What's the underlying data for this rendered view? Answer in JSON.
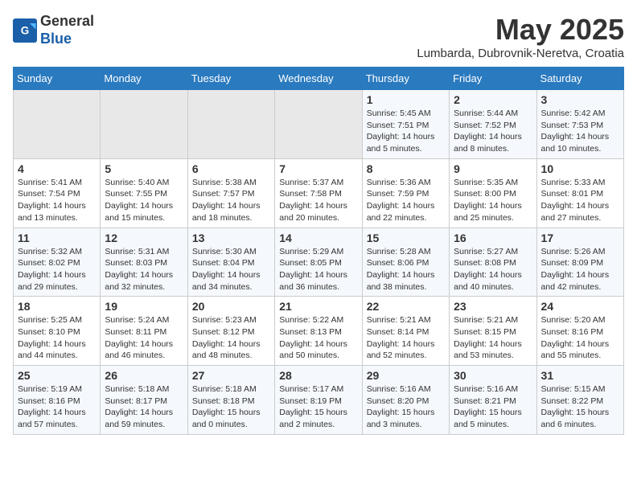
{
  "header": {
    "logo_general": "General",
    "logo_blue": "Blue",
    "month_title": "May 2025",
    "location": "Lumbarda, Dubrovnik-Neretva, Croatia"
  },
  "weekdays": [
    "Sunday",
    "Monday",
    "Tuesday",
    "Wednesday",
    "Thursday",
    "Friday",
    "Saturday"
  ],
  "weeks": [
    [
      {
        "day": "",
        "info": ""
      },
      {
        "day": "",
        "info": ""
      },
      {
        "day": "",
        "info": ""
      },
      {
        "day": "",
        "info": ""
      },
      {
        "day": "1",
        "info": "Sunrise: 5:45 AM\nSunset: 7:51 PM\nDaylight: 14 hours\nand 5 minutes."
      },
      {
        "day": "2",
        "info": "Sunrise: 5:44 AM\nSunset: 7:52 PM\nDaylight: 14 hours\nand 8 minutes."
      },
      {
        "day": "3",
        "info": "Sunrise: 5:42 AM\nSunset: 7:53 PM\nDaylight: 14 hours\nand 10 minutes."
      }
    ],
    [
      {
        "day": "4",
        "info": "Sunrise: 5:41 AM\nSunset: 7:54 PM\nDaylight: 14 hours\nand 13 minutes."
      },
      {
        "day": "5",
        "info": "Sunrise: 5:40 AM\nSunset: 7:55 PM\nDaylight: 14 hours\nand 15 minutes."
      },
      {
        "day": "6",
        "info": "Sunrise: 5:38 AM\nSunset: 7:57 PM\nDaylight: 14 hours\nand 18 minutes."
      },
      {
        "day": "7",
        "info": "Sunrise: 5:37 AM\nSunset: 7:58 PM\nDaylight: 14 hours\nand 20 minutes."
      },
      {
        "day": "8",
        "info": "Sunrise: 5:36 AM\nSunset: 7:59 PM\nDaylight: 14 hours\nand 22 minutes."
      },
      {
        "day": "9",
        "info": "Sunrise: 5:35 AM\nSunset: 8:00 PM\nDaylight: 14 hours\nand 25 minutes."
      },
      {
        "day": "10",
        "info": "Sunrise: 5:33 AM\nSunset: 8:01 PM\nDaylight: 14 hours\nand 27 minutes."
      }
    ],
    [
      {
        "day": "11",
        "info": "Sunrise: 5:32 AM\nSunset: 8:02 PM\nDaylight: 14 hours\nand 29 minutes."
      },
      {
        "day": "12",
        "info": "Sunrise: 5:31 AM\nSunset: 8:03 PM\nDaylight: 14 hours\nand 32 minutes."
      },
      {
        "day": "13",
        "info": "Sunrise: 5:30 AM\nSunset: 8:04 PM\nDaylight: 14 hours\nand 34 minutes."
      },
      {
        "day": "14",
        "info": "Sunrise: 5:29 AM\nSunset: 8:05 PM\nDaylight: 14 hours\nand 36 minutes."
      },
      {
        "day": "15",
        "info": "Sunrise: 5:28 AM\nSunset: 8:06 PM\nDaylight: 14 hours\nand 38 minutes."
      },
      {
        "day": "16",
        "info": "Sunrise: 5:27 AM\nSunset: 8:08 PM\nDaylight: 14 hours\nand 40 minutes."
      },
      {
        "day": "17",
        "info": "Sunrise: 5:26 AM\nSunset: 8:09 PM\nDaylight: 14 hours\nand 42 minutes."
      }
    ],
    [
      {
        "day": "18",
        "info": "Sunrise: 5:25 AM\nSunset: 8:10 PM\nDaylight: 14 hours\nand 44 minutes."
      },
      {
        "day": "19",
        "info": "Sunrise: 5:24 AM\nSunset: 8:11 PM\nDaylight: 14 hours\nand 46 minutes."
      },
      {
        "day": "20",
        "info": "Sunrise: 5:23 AM\nSunset: 8:12 PM\nDaylight: 14 hours\nand 48 minutes."
      },
      {
        "day": "21",
        "info": "Sunrise: 5:22 AM\nSunset: 8:13 PM\nDaylight: 14 hours\nand 50 minutes."
      },
      {
        "day": "22",
        "info": "Sunrise: 5:21 AM\nSunset: 8:14 PM\nDaylight: 14 hours\nand 52 minutes."
      },
      {
        "day": "23",
        "info": "Sunrise: 5:21 AM\nSunset: 8:15 PM\nDaylight: 14 hours\nand 53 minutes."
      },
      {
        "day": "24",
        "info": "Sunrise: 5:20 AM\nSunset: 8:16 PM\nDaylight: 14 hours\nand 55 minutes."
      }
    ],
    [
      {
        "day": "25",
        "info": "Sunrise: 5:19 AM\nSunset: 8:16 PM\nDaylight: 14 hours\nand 57 minutes."
      },
      {
        "day": "26",
        "info": "Sunrise: 5:18 AM\nSunset: 8:17 PM\nDaylight: 14 hours\nand 59 minutes."
      },
      {
        "day": "27",
        "info": "Sunrise: 5:18 AM\nSunset: 8:18 PM\nDaylight: 15 hours\nand 0 minutes."
      },
      {
        "day": "28",
        "info": "Sunrise: 5:17 AM\nSunset: 8:19 PM\nDaylight: 15 hours\nand 2 minutes."
      },
      {
        "day": "29",
        "info": "Sunrise: 5:16 AM\nSunset: 8:20 PM\nDaylight: 15 hours\nand 3 minutes."
      },
      {
        "day": "30",
        "info": "Sunrise: 5:16 AM\nSunset: 8:21 PM\nDaylight: 15 hours\nand 5 minutes."
      },
      {
        "day": "31",
        "info": "Sunrise: 5:15 AM\nSunset: 8:22 PM\nDaylight: 15 hours\nand 6 minutes."
      }
    ]
  ]
}
